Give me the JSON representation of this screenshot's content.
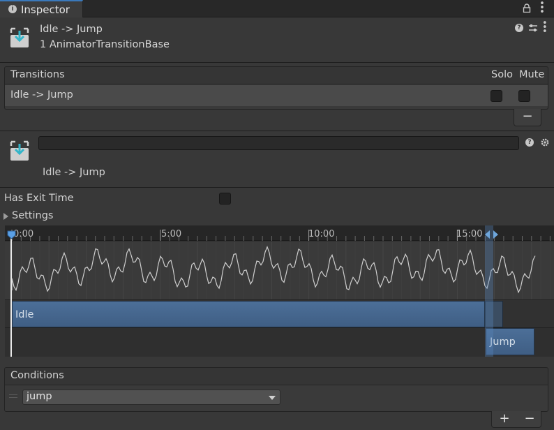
{
  "tab": {
    "title": "Inspector",
    "info_icon": "info-icon",
    "lock_icon": "lock-icon",
    "menu_icon": "kebab-menu-icon"
  },
  "header": {
    "icon": "animator-transition-icon",
    "name": "Idle -> Jump",
    "type": "1 AnimatorTransitionBase",
    "help_icon": "help-icon",
    "preset_icon": "sliders-icon",
    "menu_icon": "kebab-menu-icon"
  },
  "transitions": {
    "header_label": "Transitions",
    "solo_label": "Solo",
    "mute_label": "Mute",
    "rows": [
      {
        "label": "Idle -> Jump",
        "solo": false,
        "mute": false
      }
    ],
    "remove_button": "−"
  },
  "transition": {
    "icon": "animator-transition-icon",
    "name_field_value": "",
    "sub_label": "Idle -> Jump",
    "help_icon": "help-icon",
    "settings_icon": "gear-icon"
  },
  "options": {
    "has_exit_time_label": "Has Exit Time",
    "has_exit_time": false,
    "settings_label": "Settings"
  },
  "timeline": {
    "ruler_labels": [
      "0:00",
      "5:00",
      "10:00",
      "15:00"
    ],
    "source_state": "Idle",
    "destination_state": "Jump",
    "colors": {
      "state_bar": "#46668e",
      "overlap": "#5a87be"
    }
  },
  "conditions": {
    "header_label": "Conditions",
    "items": [
      {
        "parameter": "jump"
      }
    ],
    "add_button": "+",
    "remove_button": "−"
  }
}
